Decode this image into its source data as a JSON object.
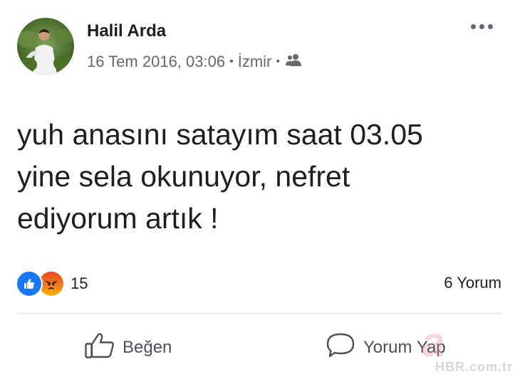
{
  "post": {
    "author": "Halil Arda",
    "date": "16 Tem 2016, 03:06",
    "location": "İzmir",
    "separator": "•",
    "audience_icon": "friends-icon",
    "more_icon": "more-options-icon",
    "text": "yuh anasını satayım saat 03.05\nyine sela okunuyor, nefret\nediyorum artık !"
  },
  "reactions": {
    "types": [
      "like",
      "angry"
    ],
    "count": "15"
  },
  "comments": {
    "count_label": "6 Yorum"
  },
  "actions": {
    "like_label": "Beğen",
    "comment_label": "Yorum Yap"
  },
  "watermark": {
    "logo_letter": "a",
    "text": "HBR.com.tr"
  },
  "colors": {
    "like_blue": "#1877f2",
    "angry_orange": "#f07a20",
    "meta_gray": "#65676b"
  }
}
